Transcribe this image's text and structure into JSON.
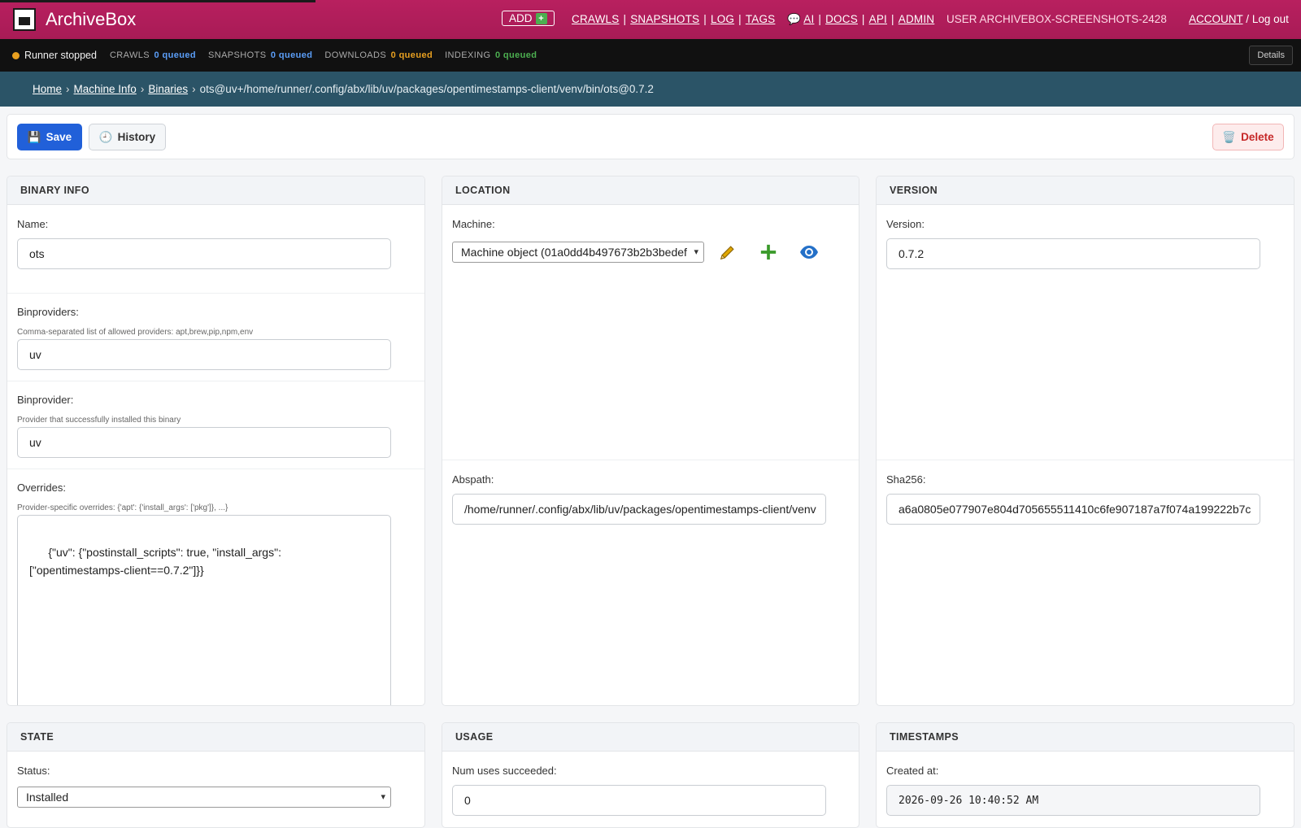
{
  "app": {
    "title": "ArchiveBox"
  },
  "header": {
    "add_label": "ADD",
    "nav_left": [
      "CRAWLS",
      "SNAPSHOTS",
      "LOG",
      "TAGS"
    ],
    "nav_ai_label": "AI",
    "nav_right": [
      "DOCS",
      "API",
      "ADMIN"
    ],
    "user_label": "USER ARCHIVEBOX-SCREENSHOTS-2428",
    "account_label": "ACCOUNT",
    "account_sep": "/",
    "logout_label": "Log out"
  },
  "status_bar": {
    "runner_text": "Runner stopped",
    "stats": [
      {
        "label": "CRAWLS",
        "value": "0 queued",
        "color": "#5b9ef8"
      },
      {
        "label": "SNAPSHOTS",
        "value": "0 queued",
        "color": "#5b9ef8"
      },
      {
        "label": "DOWNLOADS",
        "value": "0 queued",
        "color": "#e8a020"
      },
      {
        "label": "INDEXING",
        "value": "0 queued",
        "color": "#4caf50"
      }
    ],
    "details_label": "Details"
  },
  "breadcrumb": {
    "items": [
      "Home",
      "Machine Info",
      "Binaries"
    ],
    "current": "ots@uv+/home/runner/.config/abx/lib/uv/packages/opentimestamps-client/venv/bin/ots@0.7.2"
  },
  "toolbar": {
    "save_label": "Save",
    "history_label": "History",
    "delete_label": "Delete"
  },
  "binary_info": {
    "title": "BINARY INFO",
    "name_label": "Name:",
    "name_value": "ots",
    "binproviders_label": "Binproviders:",
    "binproviders_help": "Comma-separated list of allowed providers: apt,brew,pip,npm,env",
    "binproviders_value": "uv",
    "binprovider_label": "Binprovider:",
    "binprovider_help": "Provider that successfully installed this binary",
    "binprovider_value": "uv",
    "overrides_label": "Overrides:",
    "overrides_help": "Provider-specific overrides: {'apt': {'install_args': ['pkg']}, ...}",
    "overrides_value": "{\"uv\": {\"postinstall_scripts\": true, \"install_args\": [\"opentimestamps-client==0.7.2\"]}}"
  },
  "location": {
    "title": "LOCATION",
    "machine_label": "Machine:",
    "machine_value": "Machine object (01a0dd4b497673b2b3bedef",
    "abspath_label": "Abspath:",
    "abspath_value": "/home/runner/.config/abx/lib/uv/packages/opentimestamps-client/venv"
  },
  "version": {
    "title": "VERSION",
    "version_label": "Version:",
    "version_value": "0.7.2",
    "sha_label": "Sha256:",
    "sha_value": "a6a0805e077907e804d705655511410c6fe907187a7f074a199222b7c"
  },
  "state": {
    "title": "STATE",
    "status_label": "Status:",
    "status_value": "Installed"
  },
  "usage": {
    "title": "USAGE",
    "succeeded_label": "Num uses succeeded:",
    "succeeded_value": "0"
  },
  "timestamps": {
    "title": "TIMESTAMPS",
    "created_label": "Created at:",
    "created_value": "2026-09-26 10:40:52 AM"
  },
  "colors": {
    "header_bg": "#b31d5a",
    "primary": "#2160d9",
    "danger": "#c62828",
    "breadcrumb_bg": "#2b5467"
  }
}
